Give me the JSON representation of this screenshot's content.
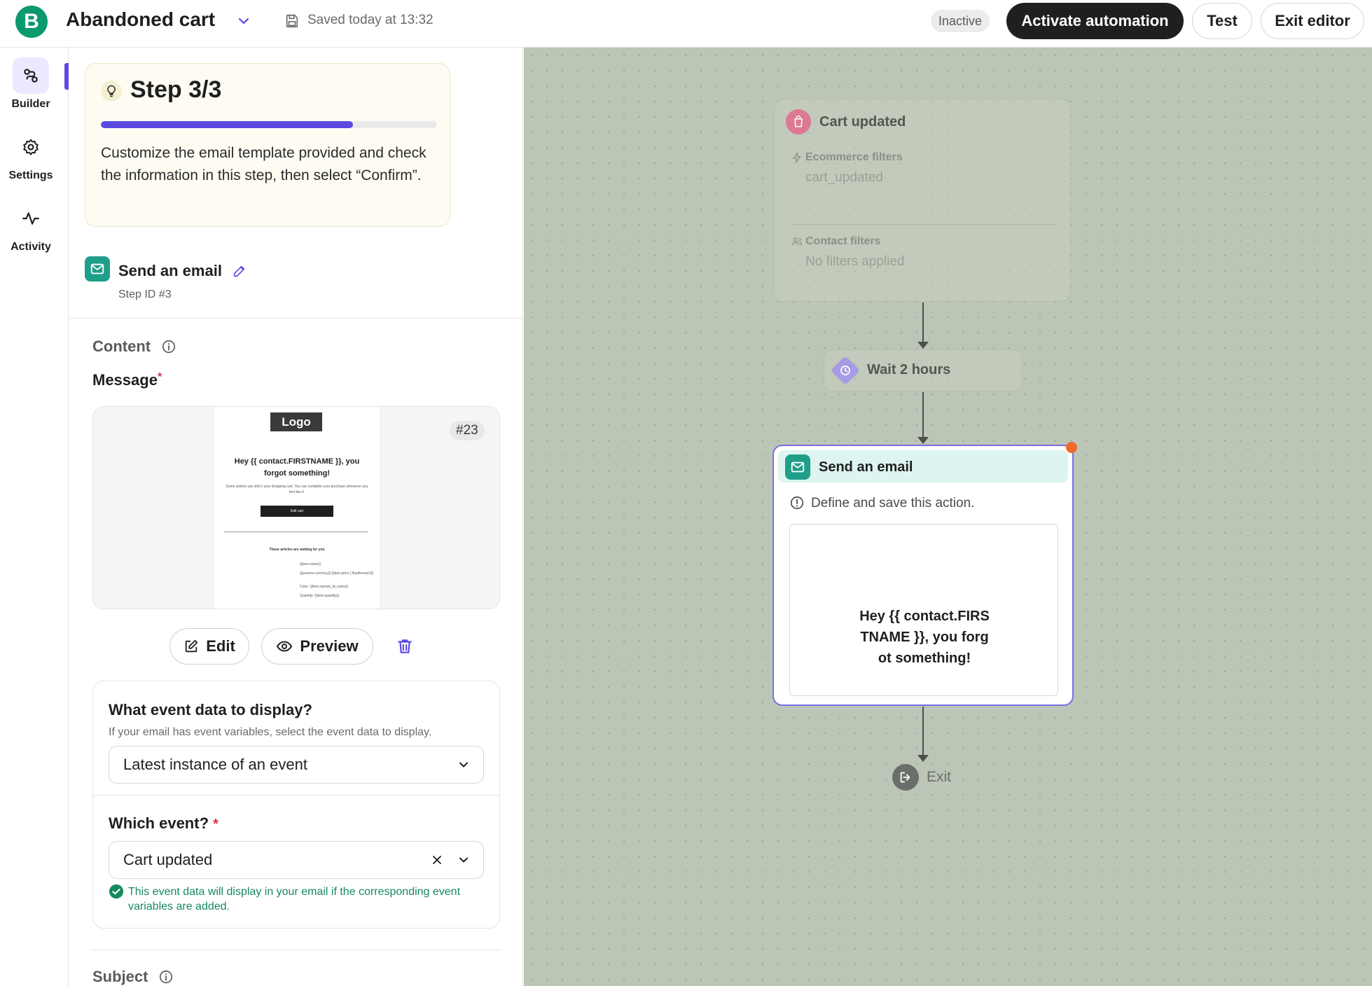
{
  "topbar": {
    "logo_letter": "B",
    "title": "Abandoned cart",
    "saved_text": "Saved today at 13:32",
    "status_badge": "Inactive",
    "activate_label": "Activate automation",
    "test_label": "Test",
    "exit_label": "Exit editor"
  },
  "leftnav": {
    "items": [
      {
        "label": "Builder",
        "icon": "builder-icon",
        "active": true
      },
      {
        "label": "Settings",
        "icon": "gear-icon",
        "active": false
      },
      {
        "label": "Activity",
        "icon": "activity-icon",
        "active": false
      }
    ]
  },
  "panel": {
    "step": {
      "title": "Step 3/3",
      "progress": 0.75,
      "description": "Customize the email template provided and check the information in this step, then select “Confirm”."
    },
    "action": {
      "title": "Send an email",
      "step_id": "Step ID #3"
    },
    "content_label": "Content",
    "message_label": "Message",
    "required_mark": "*",
    "preview": {
      "logo": "Logo",
      "heading": "Hey {{ contact.FIRSTNAME }}, you forgot something!",
      "body": "Some articles are still in your shopping cart. You can complete your purchase whenever you feel like it.",
      "button": "Edit cart",
      "sub_heading": "These articles are waiting for you",
      "vars": [
        "{{item.name}}",
        "{{params.currency}} {{item.price | floatformat:2}}",
        "Color: {{item.variant_id_name}}",
        "Quantity: {{item.quantity}}"
      ],
      "template_number": "#23"
    },
    "edit_label": "Edit",
    "preview_label": "Preview",
    "event_card": {
      "question1": "What event data to display?",
      "question1_help": "If your email has event variables, select the event data to display.",
      "select1_value": "Latest instance of an event",
      "question2": "Which event?",
      "select2_value": "Cart updated",
      "success_text": "This event data will display in your email if the corresponding event variables are added."
    },
    "subject_label": "Subject"
  },
  "canvas": {
    "trigger": {
      "title": "Cart updated",
      "ecommerce_label": "Ecommerce filters",
      "ecommerce_value": "cart_updated",
      "contact_label": "Contact filters",
      "contact_value": "No filters applied"
    },
    "wait": {
      "title": "Wait 2 hours"
    },
    "email": {
      "title": "Send an email",
      "warning": "Define and save this action.",
      "thumb_text": "Hey {{ contact.FIRSTNAME }}, you forgot something!"
    },
    "exit_label": "Exit"
  },
  "colors": {
    "brand_green": "#0b996e",
    "accent_purple": "#5b4ae0",
    "canvas_bg": "#bcc6b7",
    "email_teal": "#1f9e8a",
    "cart_pink": "#e36b8b",
    "alert_orange": "#f06a2a",
    "success_green": "#168a5d"
  }
}
